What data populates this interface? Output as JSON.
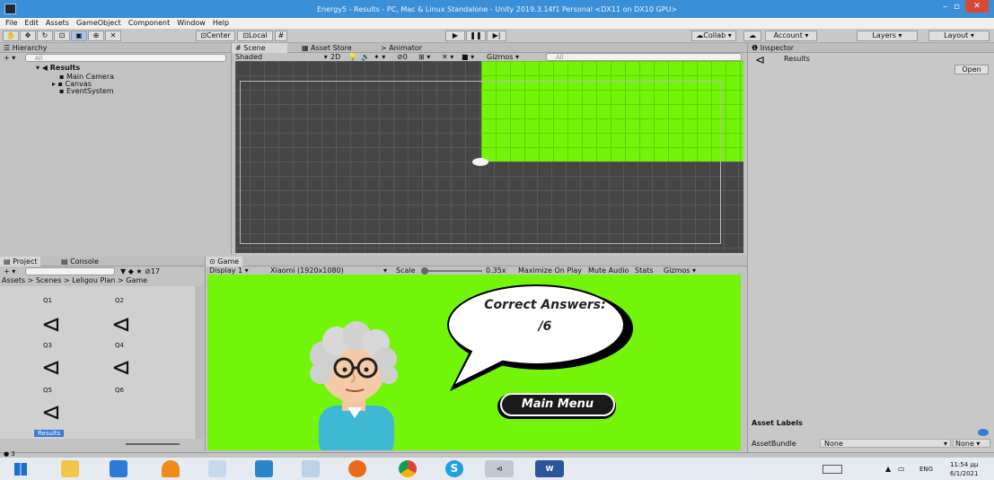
{
  "window": {
    "title": "Energy5 - Results - PC, Mac & Linux Standalone - Unity 2019.3.14f1 Personal <DX11 on DX10 GPU>"
  },
  "menu": [
    "File",
    "Edit",
    "Assets",
    "GameObject",
    "Component",
    "Window",
    "Help"
  ],
  "toolbar": {
    "center_label": "Center",
    "local_label": "Local",
    "collab_label": "Collab",
    "account_label": "Account",
    "layers_label": "Layers",
    "layout_label": "Layout"
  },
  "hierarchy": {
    "tab": "Hierarchy",
    "search_placeholder": "All",
    "scene_name": "Results",
    "items": [
      "Main Camera",
      "Canvas",
      "EventSystem"
    ]
  },
  "scene_tabs": {
    "scene": "Scene",
    "asset_store": "Asset Store",
    "animator": "Animator",
    "shading": "Shaded",
    "mode2d": "2D",
    "hidden_count": "0",
    "gizmos": "Gizmos",
    "search_placeholder": "All"
  },
  "inspector": {
    "tab": "Inspector",
    "object": "Results",
    "open_button": "Open",
    "asset_labels": "Asset Labels",
    "asset_bundle_label": "AssetBundle",
    "asset_bundle_value": "None",
    "asset_bundle_variant": "None"
  },
  "project": {
    "tab_project": "Project",
    "tab_console": "Console",
    "count": "17",
    "breadcrumb": "Assets > Scenes > Leligou Plan > Game",
    "assets": [
      "Q1",
      "Q2",
      "Q3",
      "Q4",
      "Q5",
      "Q6",
      "Results"
    ],
    "status_count": "3"
  },
  "game": {
    "tab": "Game",
    "display": "Display 1",
    "resolution": "Xiaomi (1920x1080)",
    "scale_label": "Scale",
    "scale_value": "0.35x",
    "maximize": "Maximize On Play",
    "mute": "Mute Audio",
    "stats": "Stats",
    "gizmos": "Gizmos",
    "bubble_title": "Correct Answers:",
    "bubble_score": "/6",
    "main_menu": "Main Menu"
  },
  "taskbar": {
    "lang": "ENG",
    "time": "11:54 μμ",
    "date": "6/1/2021"
  },
  "colors": {
    "game_green": "#73f50a",
    "titlebar_blue": "#3b8fd6",
    "scene_grid": "#464646"
  }
}
